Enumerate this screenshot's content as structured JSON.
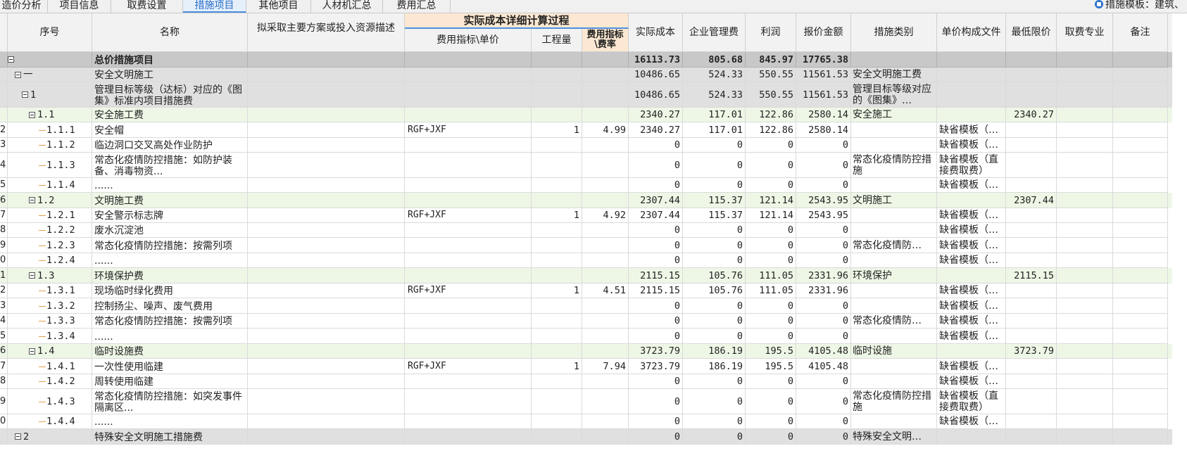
{
  "tabs": [
    {
      "label": "造价分析"
    },
    {
      "label": "项目信息"
    },
    {
      "label": "取费设置"
    },
    {
      "label": "措施项目",
      "active": true
    },
    {
      "label": "其他项目"
    },
    {
      "label": "人材机汇总"
    },
    {
      "label": "费用汇总"
    }
  ],
  "template_label": "措施模板：建筑、",
  "headers": {
    "seq": "序号",
    "name": "名称",
    "plan": "拟采取主要方案或投入资源描述",
    "group": "实际成本详细计算过程",
    "index": "费用指标\\单价",
    "qty": "工程量",
    "rate": "费用指标\\费率",
    "cost": "实际成本",
    "mgmt": "企业管理费",
    "profit": "利润",
    "quote": "报价金额",
    "cat": "措施类别",
    "file": "单价构成文件",
    "min": "最低限价",
    "spec": "取费专业",
    "note": "备注"
  },
  "rows": [
    {
      "type": "total",
      "rn": "",
      "seq": "",
      "name": "总价措施项目",
      "index": "",
      "qty": "",
      "rate": "",
      "cost": "16113.73",
      "mgmt": "805.68",
      "profit": "845.97",
      "quote": "17765.38",
      "cat": "",
      "file": "",
      "min": ""
    },
    {
      "type": "sec",
      "rn": "",
      "seq": "一",
      "name": "安全文明施工",
      "index": "",
      "qty": "",
      "rate": "",
      "cost": "10486.65",
      "mgmt": "524.33",
      "profit": "550.55",
      "quote": "11561.53",
      "cat": "安全文明施工费",
      "file": "",
      "min": ""
    },
    {
      "type": "sub",
      "rn": "",
      "seq": "1",
      "name": "管理目标等级（达标）对应的《图集》标准内项目措施费",
      "index": "",
      "qty": "",
      "rate": "",
      "cost": "10486.65",
      "mgmt": "524.33",
      "profit": "550.55",
      "quote": "11561.53",
      "cat": "管理目标等级对应的《图集》…",
      "file": "",
      "min": ""
    },
    {
      "type": "grp",
      "rn": "",
      "seq": "1.1",
      "name": "安全施工费",
      "index": "",
      "qty": "",
      "rate": "",
      "cost": "2340.27",
      "mgmt": "117.01",
      "profit": "122.86",
      "quote": "2580.14",
      "cat": "安全施工",
      "file": "",
      "min": "2340.27"
    },
    {
      "type": "item",
      "rn": "2",
      "seq": "1.1.1",
      "name": "安全帽",
      "index": "RGF+JXF",
      "qty": "1",
      "rate": "4.99",
      "cost": "2340.27",
      "mgmt": "117.01",
      "profit": "122.86",
      "quote": "2580.14",
      "cat": "",
      "file": "缺省模板（…",
      "min": ""
    },
    {
      "type": "item",
      "rn": "3",
      "seq": "1.1.2",
      "name": "临边洞口交叉高处作业防护",
      "index": "",
      "qty": "",
      "rate": "",
      "cost": "0",
      "mgmt": "0",
      "profit": "0",
      "quote": "0",
      "cat": "",
      "file": "缺省模板（…",
      "min": ""
    },
    {
      "type": "item",
      "rn": "4",
      "seq": "1.1.3",
      "name": "常态化疫情防控措施：如防护装备、消毒物资...",
      "index": "",
      "qty": "",
      "rate": "",
      "cost": "0",
      "mgmt": "0",
      "profit": "0",
      "quote": "0",
      "cat": "常态化疫情防控措施",
      "file": "缺省模板（直接费取费）",
      "min": ""
    },
    {
      "type": "item",
      "rn": "5",
      "seq": "1.1.4",
      "name": "......",
      "index": "",
      "qty": "",
      "rate": "",
      "cost": "0",
      "mgmt": "0",
      "profit": "0",
      "quote": "0",
      "cat": "",
      "file": "缺省模板（…",
      "min": ""
    },
    {
      "type": "grp",
      "rn": "6",
      "seq": "1.2",
      "name": "文明施工费",
      "index": "",
      "qty": "",
      "rate": "",
      "cost": "2307.44",
      "mgmt": "115.37",
      "profit": "121.14",
      "quote": "2543.95",
      "cat": "文明施工",
      "file": "",
      "min": "2307.44"
    },
    {
      "type": "item",
      "rn": "7",
      "seq": "1.2.1",
      "name": "安全警示标志牌",
      "index": "RGF+JXF",
      "qty": "1",
      "rate": "4.92",
      "cost": "2307.44",
      "mgmt": "115.37",
      "profit": "121.14",
      "quote": "2543.95",
      "cat": "",
      "file": "缺省模板（…",
      "min": ""
    },
    {
      "type": "item",
      "rn": "8",
      "seq": "1.2.2",
      "name": "废水沉淀池",
      "index": "",
      "qty": "",
      "rate": "",
      "cost": "0",
      "mgmt": "0",
      "profit": "0",
      "quote": "0",
      "cat": "",
      "file": "缺省模板（…",
      "min": ""
    },
    {
      "type": "item",
      "rn": "9",
      "seq": "1.2.3",
      "name": "常态化疫情防控措施：按需列项",
      "index": "",
      "qty": "",
      "rate": "",
      "cost": "0",
      "mgmt": "0",
      "profit": "0",
      "quote": "0",
      "cat": "常态化疫情防…",
      "file": "缺省模板（…",
      "min": ""
    },
    {
      "type": "item",
      "rn": "0",
      "seq": "1.2.4",
      "name": "......",
      "index": "",
      "qty": "",
      "rate": "",
      "cost": "0",
      "mgmt": "0",
      "profit": "0",
      "quote": "0",
      "cat": "",
      "file": "缺省模板（…",
      "min": ""
    },
    {
      "type": "grp",
      "rn": "1",
      "seq": "1.3",
      "name": "环境保护费",
      "index": "",
      "qty": "",
      "rate": "",
      "cost": "2115.15",
      "mgmt": "105.76",
      "profit": "111.05",
      "quote": "2331.96",
      "cat": "环境保护",
      "file": "",
      "min": "2115.15"
    },
    {
      "type": "item",
      "rn": "2",
      "seq": "1.3.1",
      "name": "现场临时绿化费用",
      "index": "RGF+JXF",
      "qty": "1",
      "rate": "4.51",
      "cost": "2115.15",
      "mgmt": "105.76",
      "profit": "111.05",
      "quote": "2331.96",
      "cat": "",
      "file": "缺省模板（…",
      "min": ""
    },
    {
      "type": "item",
      "rn": "3",
      "seq": "1.3.2",
      "name": "控制扬尘、噪声、废气费用",
      "index": "",
      "qty": "",
      "rate": "",
      "cost": "0",
      "mgmt": "0",
      "profit": "0",
      "quote": "0",
      "cat": "",
      "file": "缺省模板（…",
      "min": ""
    },
    {
      "type": "item",
      "rn": "4",
      "seq": "1.3.3",
      "name": "常态化疫情防控措施：按需列项",
      "index": "",
      "qty": "",
      "rate": "",
      "cost": "0",
      "mgmt": "0",
      "profit": "0",
      "quote": "0",
      "cat": "常态化疫情防…",
      "file": "缺省模板（…",
      "min": ""
    },
    {
      "type": "item",
      "rn": "5",
      "seq": "1.3.4",
      "name": "......",
      "index": "",
      "qty": "",
      "rate": "",
      "cost": "0",
      "mgmt": "0",
      "profit": "0",
      "quote": "0",
      "cat": "",
      "file": "缺省模板（…",
      "min": ""
    },
    {
      "type": "grp",
      "rn": "6",
      "seq": "1.4",
      "name": "临时设施费",
      "index": "",
      "qty": "",
      "rate": "",
      "cost": "3723.79",
      "mgmt": "186.19",
      "profit": "195.5",
      "quote": "4105.48",
      "cat": "临时设施",
      "file": "",
      "min": "3723.79"
    },
    {
      "type": "item",
      "rn": "7",
      "seq": "1.4.1",
      "name": "一次性使用临建",
      "index": "RGF+JXF",
      "qty": "1",
      "rate": "7.94",
      "cost": "3723.79",
      "mgmt": "186.19",
      "profit": "195.5",
      "quote": "4105.48",
      "cat": "",
      "file": "缺省模板（…",
      "min": ""
    },
    {
      "type": "item",
      "rn": "8",
      "seq": "1.4.2",
      "name": "周转使用临建",
      "index": "",
      "qty": "",
      "rate": "",
      "cost": "0",
      "mgmt": "0",
      "profit": "0",
      "quote": "0",
      "cat": "",
      "file": "缺省模板（…",
      "min": ""
    },
    {
      "type": "item",
      "rn": "9",
      "seq": "1.4.3",
      "name": "常态化疫情防控措施：如突发事件隔离区...",
      "index": "",
      "qty": "",
      "rate": "",
      "cost": "0",
      "mgmt": "0",
      "profit": "0",
      "quote": "0",
      "cat": "常态化疫情防控措施",
      "file": "缺省模板（直接费取费）",
      "min": ""
    },
    {
      "type": "item",
      "rn": "0",
      "seq": "1.4.4",
      "name": "......",
      "index": "",
      "qty": "",
      "rate": "",
      "cost": "0",
      "mgmt": "0",
      "profit": "0",
      "quote": "0",
      "cat": "",
      "file": "缺省模板（…",
      "min": ""
    },
    {
      "type": "sec",
      "rn": "",
      "seq": "2",
      "name": "特殊安全文明施工措施费",
      "index": "",
      "qty": "",
      "rate": "",
      "cost": "0",
      "mgmt": "0",
      "profit": "0",
      "quote": "0",
      "cat": "特殊安全文明…",
      "file": "",
      "min": ""
    }
  ]
}
